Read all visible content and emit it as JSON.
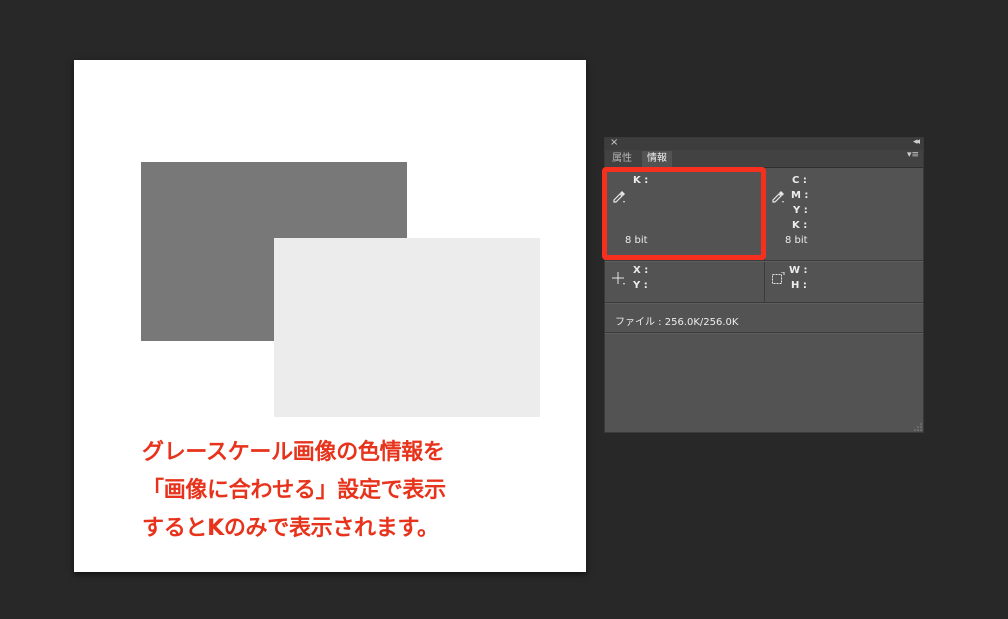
{
  "canvas": {
    "dark_rect_color": "#787878",
    "light_rect_color": "#ececec",
    "caption_lines": [
      "グレースケール画像の色情報を",
      "「画像に合わせる」設定で表示",
      "するとKのみで表示されます。"
    ],
    "caption_color": "#e8331c"
  },
  "panel": {
    "close_glyph": "×",
    "collapse_glyph": "◂◂",
    "tabs": [
      {
        "label": "属性",
        "active": false
      },
      {
        "label": "情報",
        "active": true
      }
    ],
    "menu_glyph": "▾≡",
    "left_readout": {
      "labels": [
        "K :"
      ],
      "bit_depth": "8 bit"
    },
    "right_readout": {
      "labels": [
        "C :",
        "M :",
        "Y :",
        "K :"
      ],
      "bit_depth": "8 bit"
    },
    "position": {
      "labels": [
        "X :",
        "Y :"
      ]
    },
    "size": {
      "labels": [
        "W :",
        "H :"
      ]
    },
    "file_info": "ファイル : 256.0K/256.0K"
  },
  "highlight_color": "#f5301f"
}
